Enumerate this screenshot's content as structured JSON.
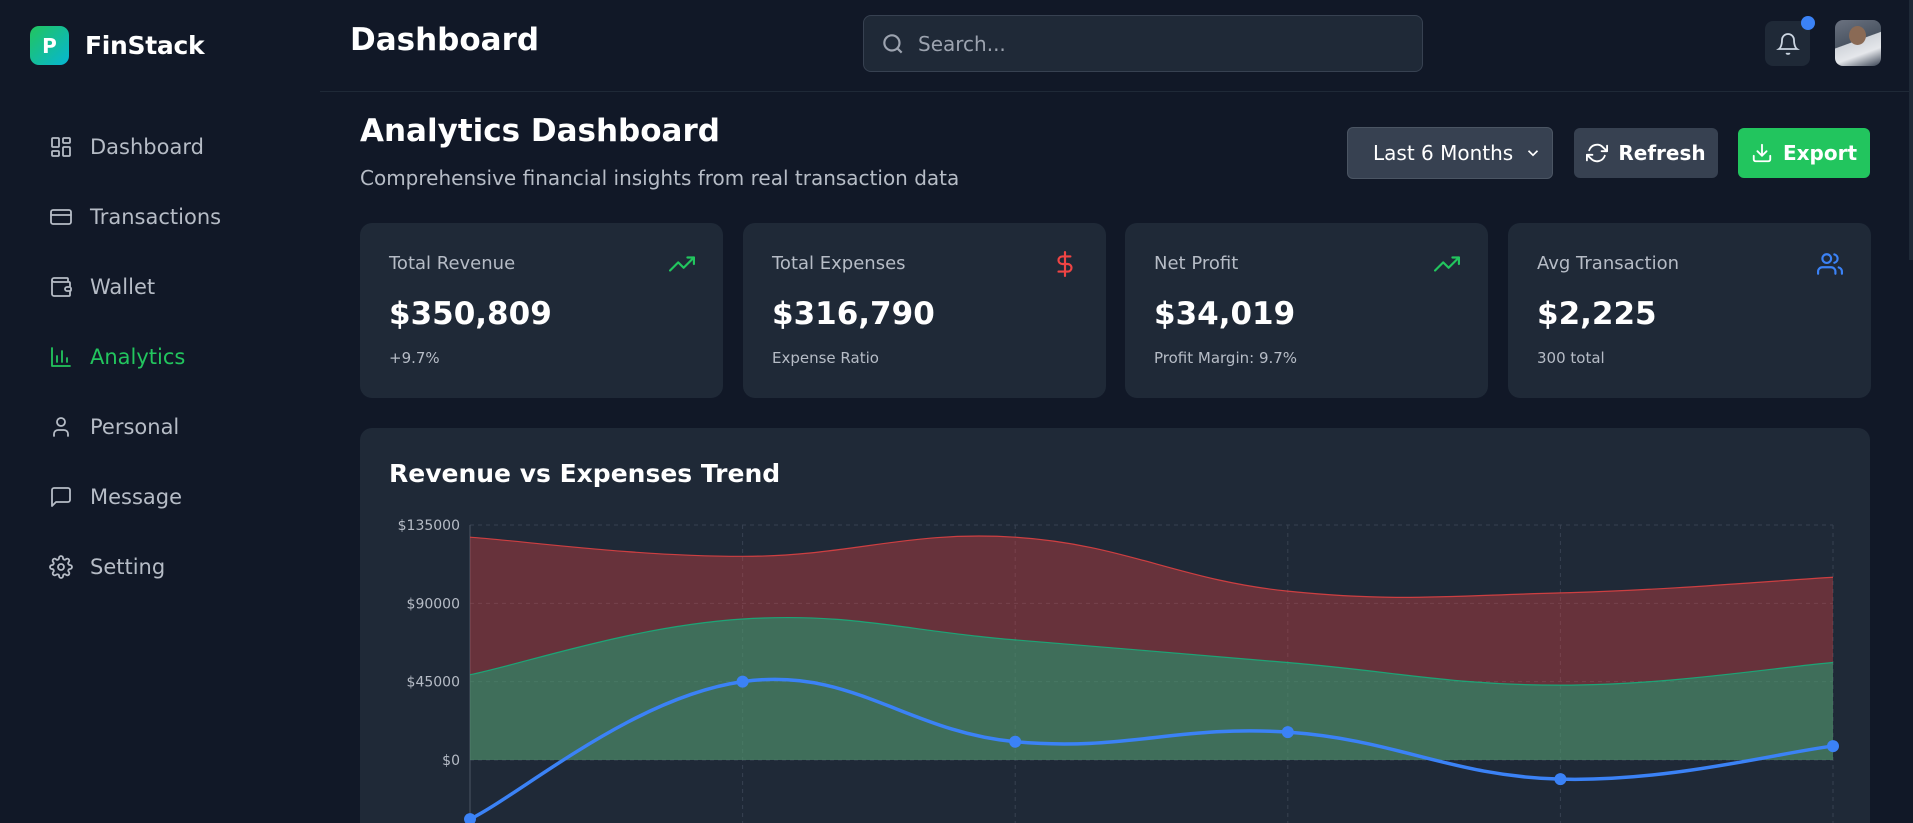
{
  "brand": {
    "logo_letter": "P",
    "name": "FinStack"
  },
  "sidebar": {
    "items": [
      {
        "label": "Dashboard",
        "icon": "dashboard-icon",
        "active": false
      },
      {
        "label": "Transactions",
        "icon": "credit-card-icon",
        "active": false
      },
      {
        "label": "Wallet",
        "icon": "wallet-icon",
        "active": false
      },
      {
        "label": "Analytics",
        "icon": "bar-chart-icon",
        "active": true
      },
      {
        "label": "Personal",
        "icon": "user-icon",
        "active": false
      },
      {
        "label": "Message",
        "icon": "message-icon",
        "active": false
      },
      {
        "label": "Setting",
        "icon": "gear-icon",
        "active": false
      }
    ]
  },
  "header": {
    "title": "Dashboard",
    "search_placeholder": "Search...",
    "has_notification": true
  },
  "main": {
    "title": "Analytics Dashboard",
    "subtitle": "Comprehensive financial insights from real transaction data",
    "period": "Last 6 Months",
    "refresh_label": "Refresh",
    "export_label": "Export"
  },
  "stats": [
    {
      "label": "Total Revenue",
      "value": "$350,809",
      "note": "+9.7%",
      "icon": "trending-up-icon",
      "color": "#22c55e"
    },
    {
      "label": "Total Expenses",
      "value": "$316,790",
      "note": "Expense Ratio",
      "icon": "dollar-icon",
      "color": "#ef4444"
    },
    {
      "label": "Net Profit",
      "value": "$34,019",
      "note": "Profit Margin: 9.7%",
      "icon": "trending-up-icon",
      "color": "#22c55e"
    },
    {
      "label": "Avg Transaction",
      "value": "$2,225",
      "note": "300 total",
      "icon": "users-icon",
      "color": "#3b82f6"
    }
  ],
  "colors": {
    "accent": "#22c55e",
    "expense": "#ef4444",
    "profit_line": "#3b82f6",
    "card_bg": "#1f2937",
    "page_bg": "#111827"
  },
  "chart_data": {
    "type": "area",
    "title": "Revenue vs Expenses Trend",
    "y_ticks": [
      "$135000",
      "$90000",
      "$45000",
      "$0"
    ],
    "ylim_visible": [
      0,
      135000
    ],
    "grid": true,
    "series": [
      {
        "values": [
          128000,
          117000,
          128000,
          97000,
          96000,
          105000
        ],
        "color": "#ef4444",
        "type": "area"
      },
      {
        "values": [
          49000,
          81000,
          69000,
          56000,
          43000,
          56000
        ],
        "color": "#10b981",
        "type": "area"
      },
      {
        "values": [
          -34000,
          45000,
          10500,
          16000,
          -11000,
          8000
        ],
        "color": "#3b82f6",
        "type": "line"
      }
    ]
  }
}
